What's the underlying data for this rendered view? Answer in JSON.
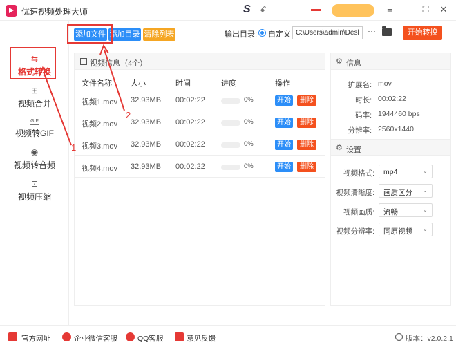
{
  "app": {
    "title": "优速视频处理大师",
    "brand_mark": "S",
    "brand_dot": "ꗃ",
    "accent": "#2c8ef8",
    "danger": "#f4511e",
    "warning": "#f5a623"
  },
  "window": {
    "menu_icon": "≡",
    "minimize_icon": "—",
    "maximize_icon": "⛶",
    "close_icon": "✕"
  },
  "sidebar": {
    "items": [
      {
        "label": "格式转换",
        "icon": "⇆",
        "active": true
      },
      {
        "label": "视频合并",
        "icon": "⊞"
      },
      {
        "label": "视频转GIF",
        "icon": "GIF"
      },
      {
        "label": "视频转音频",
        "icon": "◉"
      },
      {
        "label": "视频压缩",
        "icon": "⊡"
      }
    ]
  },
  "toolbar": {
    "add_file": "添加文件",
    "add_dir": "添加目录",
    "clear_list": "清除列表",
    "output_label": "输出目录:",
    "custom_label": "自定义",
    "path_value": "C:\\Users\\admin\\Deskto",
    "ellipsis": "···",
    "start_all": "开始转换"
  },
  "file_panel": {
    "title": "视频信息（4个）",
    "columns": [
      "文件名称",
      "大小",
      "时间",
      "进度",
      "操作"
    ],
    "rows": [
      {
        "name": "视频1.mov",
        "size": "32.93MB",
        "time": "00:02:22",
        "progress": "0%",
        "start": "开始",
        "delete": "删除"
      },
      {
        "name": "视频2.mov",
        "size": "32.93MB",
        "time": "00:02:22",
        "progress": "0%",
        "start": "开始",
        "delete": "删除"
      },
      {
        "name": "视频3.mov",
        "size": "32.93MB",
        "time": "00:02:22",
        "progress": "0%",
        "start": "开始",
        "delete": "删除"
      },
      {
        "name": "视频4.mov",
        "size": "32.93MB",
        "time": "00:02:22",
        "progress": "0%",
        "start": "开始",
        "delete": "删除"
      }
    ]
  },
  "info_panel": {
    "title": "信息",
    "items": [
      {
        "label": "扩展名:",
        "value": "mov"
      },
      {
        "label": "时长:",
        "value": "00:02:22"
      },
      {
        "label": "码率:",
        "value": "1944460 bps"
      },
      {
        "label": "分辨率:",
        "value": "2560x1440"
      }
    ]
  },
  "settings_panel": {
    "title": "设置",
    "items": [
      {
        "label": "视频格式:",
        "value": "mp4"
      },
      {
        "label": "视频清晰度:",
        "value": "画质区分"
      },
      {
        "label": "视频画质:",
        "value": "流畅"
      },
      {
        "label": "视频分辨率:",
        "value": "同原视频"
      }
    ]
  },
  "footer": {
    "links": [
      "官方网址",
      "企业微信客服",
      "QQ客服",
      "意见反馈"
    ],
    "version": "版本：v2.0.2.1"
  },
  "annotations": {
    "one": "1",
    "two": "2"
  }
}
